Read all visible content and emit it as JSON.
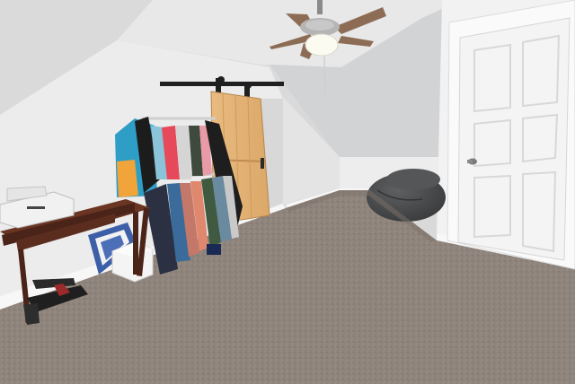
{
  "scene": {
    "description_label": "",
    "colors": {
      "wall": "#ececec",
      "ceiling": "#e6e6e6",
      "ceiling_shadow": "#cfcfcf",
      "carpet": "#8f847c",
      "carpet_dark": "#7b716a",
      "door": "#f4f4f4",
      "barn_door": "#e7b77a",
      "barn_rail": "#1f1f1f",
      "desk": "#5a2d1f",
      "beanbag": "#4a4b4c",
      "baseboard": "#f7f7f7"
    }
  }
}
